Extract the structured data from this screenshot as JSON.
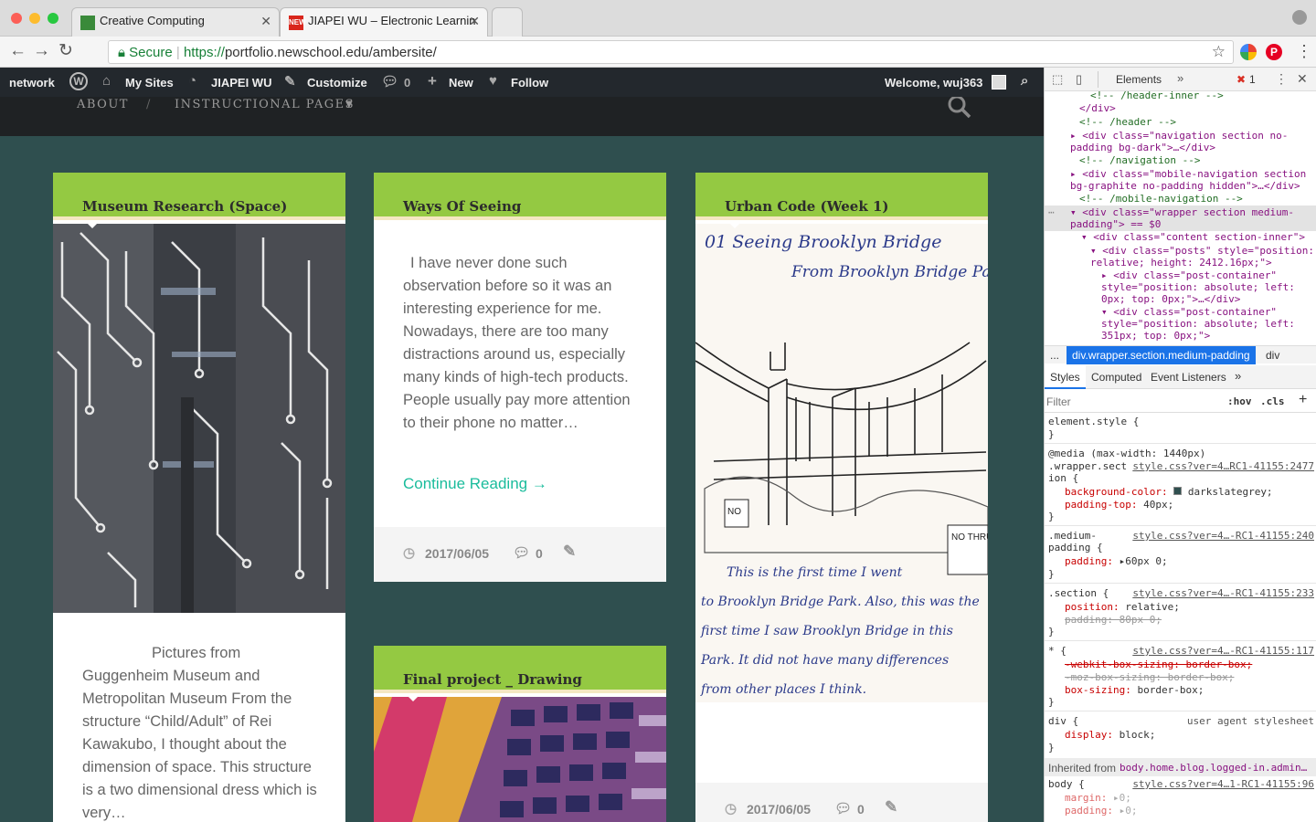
{
  "browser": {
    "tabs": [
      {
        "title": "Creative Computing"
      },
      {
        "title": "JIAPEI WU – Electronic Learnin"
      }
    ],
    "secure_label": "Secure",
    "url_scheme": "https://",
    "url_rest": "portfolio.newschool.edu/ambersite/"
  },
  "wp_bar": {
    "network": "network",
    "my_sites": "My Sites",
    "site_name": "JIAPEI WU",
    "customize": "Customize",
    "comments_count": "0",
    "new": "New",
    "follow": "Follow",
    "welcome": "Welcome, wuj363"
  },
  "site_nav": {
    "about": "ABOUT",
    "separator": "/",
    "instructional": "INSTRUCTIONAL PAGES"
  },
  "posts": [
    {
      "title": "Museum Research (Space)",
      "excerpt": "Pictures from Guggenheim Museum and Metropolitan Museum   From the structure “Child/Adult” of Rei Kawakubo, I thought about the dimension of space. This structure is a two dimensional dress which is very…"
    },
    {
      "title": "Ways Of Seeing",
      "excerpt": "I have never done such observation before so it was an interesting experience for me. Nowadays, there are too many distractions around us, especially many kinds of high-tech products. People usually pay more attention to their phone no matter…",
      "continue": "Continue Reading →",
      "date": "2017/06/05",
      "comments": "0"
    },
    {
      "title": "Urban Code (Week 1)",
      "sketch_lines": [
        "01  Seeing  Brooklyn  Bridge",
        "From  Brooklyn  Bridge  Park"
      ],
      "sketch_caption": [
        "This  is  the  first  time  I  went",
        "to  Brooklyn  Bridge  Park.  Also,  this  was  the",
        "first  time  I  saw  Brooklyn  Bridge  in  this",
        "Park.  It  did  not  have  many  differences",
        "from  other  places  I  think."
      ],
      "sign_no": "NO",
      "sign_thru": "NO THRU TRAFF",
      "date": "2017/06/05",
      "comments": "0"
    },
    {
      "title": "Final project _ Drawing"
    }
  ],
  "devtools": {
    "tab_elements": "Elements",
    "error_count": "1",
    "dom": [
      "<!-- /header-inner -->",
      "</div>",
      "<!-- /header -->",
      "<div class=\"navigation section no-",
      "padding bg-dark\">…</div>",
      "<!-- /navigation -->",
      "<div class=\"mobile-navigation section",
      "bg-graphite no-padding hidden\">…</div>",
      "<!-- /mobile-navigation -->",
      "<div class=\"wrapper section medium-",
      "padding\"> == $0",
      "<div class=\"content section-inner\">",
      "<div class=\"posts\" style=\"position:",
      "relative; height: 2412.16px;\">",
      "<div class=\"post-container\"",
      "style=\"position: absolute; left:",
      "0px; top: 0px;\">…</div>",
      "<div class=\"post-container\"",
      "style=\"position: absolute; left:",
      "351px; top: 0px;\">"
    ],
    "breadcrumb_ellipsis": "...",
    "breadcrumb_selected": "div.wrapper.section.medium-padding",
    "breadcrumb_next": "div",
    "sub_tabs": [
      "Styles",
      "Computed",
      "Event Listeners"
    ],
    "filter_placeholder": "Filter",
    "hov": ":hov",
    "cls": ".cls",
    "css": {
      "element_style": "element.style {",
      "close": "}",
      "media": "@media (max-width: 1440px)",
      "sel1a": ".wrapper.sect",
      "sel1b": "ion {",
      "link1": "style.css?ver=4…RC1-41155:2477",
      "bg_prop": "background-color:",
      "bg_val": "darkslategrey;",
      "pt_prop": "padding-top:",
      "pt_val": "40px;",
      "sel2a": ".medium-",
      "sel2b": "padding {",
      "link2": "style.css?ver=4…-RC1-41155:240",
      "pad_prop": "padding:",
      "pad_val": "60px 0;",
      "sel3": ".section {",
      "link3": "style.css?ver=4…-RC1-41155:233",
      "pos_prop": "position:",
      "pos_val": "relative;",
      "pad2": "padding: 80px 0;",
      "sel4": "* {",
      "link4": "style.css?ver=4…-RC1-41155:117",
      "webkit": "-webkit-box-sizing: border-box;",
      "moz": "-moz-box-sizing: border-box;",
      "bs_prop": "box-sizing:",
      "bs_val": "border-box;",
      "sel5": "div {",
      "ua": "user agent stylesheet",
      "disp_prop": "display:",
      "disp_val": "block;",
      "inherited": "Inherited from",
      "inherited_link": "body.home.blog.logged-in.admin…",
      "sel6": "body {",
      "link6": "style.css?ver=4…1-RC1-41155:96",
      "m_prop": "margin:",
      "m_val": "0;",
      "p_prop": "padding:",
      "p_val": "0;"
    }
  },
  "colors": {
    "site_bg": "#2f4f4f",
    "card_header": "#94c942",
    "link_green": "#1abc9c"
  }
}
